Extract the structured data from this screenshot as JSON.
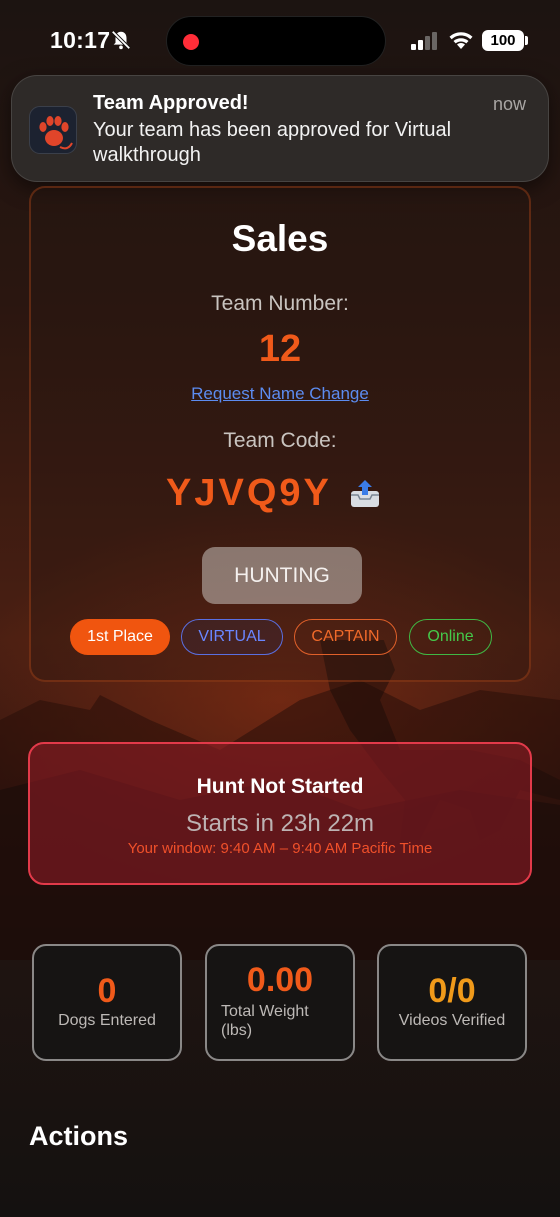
{
  "status_bar": {
    "time": "10:17",
    "battery": "100"
  },
  "notification": {
    "title": "Team Approved!",
    "time": "now",
    "body": "Your team has been approved for Virtual walkthrough"
  },
  "team": {
    "name": "Sales",
    "number_label": "Team Number:",
    "number": "12",
    "name_change_link": "Request Name Change",
    "code_label": "Team Code:",
    "code": "YJVQ9Y",
    "status": "HUNTING",
    "badges": {
      "place": "1st Place",
      "mode": "VIRTUAL",
      "role": "CAPTAIN",
      "connection": "Online"
    }
  },
  "hunt": {
    "title": "Hunt Not Started",
    "countdown": "Starts in 23h 22m",
    "window": "Your window: 9:40 AM – 9:40 AM Pacific Time"
  },
  "stats": [
    {
      "value": "0",
      "label": "Dogs Entered"
    },
    {
      "value": "0.00",
      "label": "Total Weight\n(lbs)"
    },
    {
      "value": "0/0",
      "label": "Videos Verified"
    }
  ],
  "actions": {
    "heading": "Actions"
  },
  "colors": {
    "accent": "#f05a1a",
    "danger": "#e23a4a",
    "link": "#5c8cf0",
    "online": "#45c84a",
    "virtual": "#6a86ff",
    "amber": "#f09a1a"
  },
  "icons": [
    "bell-off-icon",
    "signal-icon",
    "wifi-icon",
    "paw-icon",
    "share-icon"
  ]
}
